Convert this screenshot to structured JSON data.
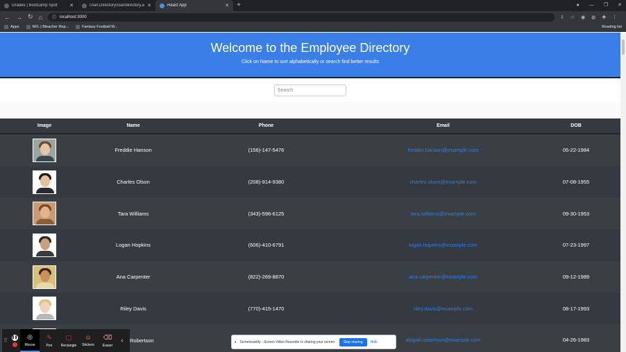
{
  "browser": {
    "tabs": [
      {
        "title": "Grades | Bootcamp Spot",
        "active": false
      },
      {
        "title": "User.Directory/userdirectory.at",
        "active": false
      },
      {
        "title": "React App",
        "active": true
      }
    ],
    "url": "localhost:3000",
    "bookmarks": [
      {
        "label": "Apps"
      },
      {
        "label": "NFL | Bleacher Rep..."
      },
      {
        "label": "Fantasy Football M..."
      }
    ],
    "reading_list": "Reading list"
  },
  "hero": {
    "title": "Welcome to the Employee Directory",
    "subtitle": "Click on Name to sort alphabetically or search find better results"
  },
  "search": {
    "placeholder": "Search"
  },
  "table": {
    "headers": [
      "Image",
      "Name",
      "Phone",
      "Email",
      "DOB"
    ],
    "rows": [
      {
        "name": "Freddie Hanson",
        "phone": "(156)-147-5476",
        "email": "freddie.hanson@example.com",
        "dob": "05-22-1984"
      },
      {
        "name": "Charles Olson",
        "phone": "(208)-914-9380",
        "email": "charles.olson@example.com",
        "dob": "07-08-1955"
      },
      {
        "name": "Tara Williams",
        "phone": "(343)-596-6125",
        "email": "tara.williams@example.com",
        "dob": "09-30-1953"
      },
      {
        "name": "Logan Hopkins",
        "phone": "(606)-410-6791",
        "email": "logan.hopkins@example.com",
        "dob": "07-23-1997"
      },
      {
        "name": "Ana Carpenter",
        "phone": "(822)-269-8870",
        "email": "ana.carpenter@example.com",
        "dob": "09-12-1989"
      },
      {
        "name": "Riley Davis",
        "phone": "(770)-415-1470",
        "email": "riley.davis@example.com",
        "dob": "08-17-1993"
      },
      {
        "name": "Robertson",
        "phone": "",
        "email": "abigail.robertson@example.com",
        "dob": "04-26-1983"
      }
    ]
  },
  "screencastify": {
    "tools": [
      {
        "label": "Mouse",
        "icon": "mouse-icon",
        "active": true
      },
      {
        "label": "Pen",
        "icon": "pen-icon",
        "active": false
      },
      {
        "label": "Rectangle",
        "icon": "rectangle-icon",
        "active": false
      },
      {
        "label": "Stickers",
        "icon": "sticker-icon",
        "active": false
      },
      {
        "label": "Eraser",
        "icon": "eraser-icon",
        "active": false
      }
    ],
    "share_message": "Screencastify - Screen Video Recorder is sharing your screen.",
    "stop_label": "Stop sharing",
    "hide_label": "Hide"
  },
  "colors": {
    "hero_bg": "#3a7ee8",
    "table_dark": "#343a40",
    "link": "#2e7fe8"
  }
}
